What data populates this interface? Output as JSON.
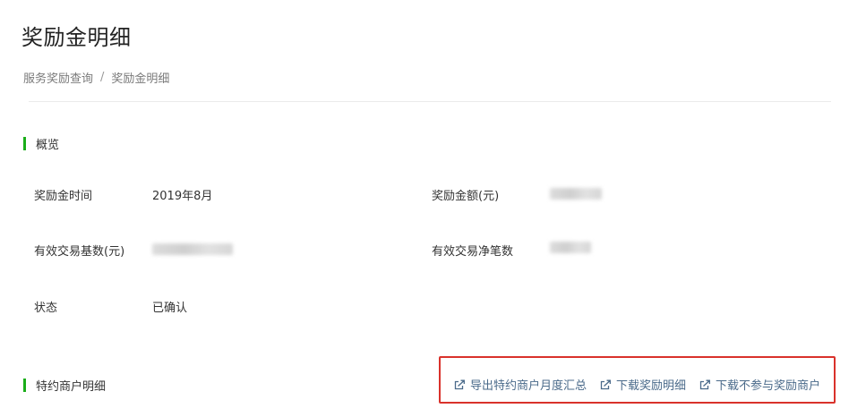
{
  "header": {
    "title": "奖励金明细"
  },
  "breadcrumb": {
    "parent": "服务奖励查询",
    "separator": "/",
    "current": "奖励金明细"
  },
  "overview": {
    "section_title": "概览",
    "fields": {
      "reward_time": {
        "label": "奖励金时间",
        "value": "2019年8月"
      },
      "reward_amount": {
        "label": "奖励金额(元)"
      },
      "valid_tx_base": {
        "label": "有效交易基数(元)"
      },
      "valid_tx_count": {
        "label": "有效交易净笔数"
      },
      "status": {
        "label": "状态",
        "value": "已确认"
      }
    }
  },
  "merchant_detail": {
    "section_title": "特约商户明细",
    "actions": [
      {
        "label": "导出特约商户月度汇总",
        "icon": "export-icon"
      },
      {
        "label": "下载奖励明细",
        "icon": "export-icon"
      },
      {
        "label": "下载不参与奖励商户",
        "icon": "export-icon"
      }
    ]
  },
  "colors": {
    "accent_green": "#1aad19",
    "highlight_red": "#d9322b",
    "link_blue": "#4a6a8a"
  }
}
